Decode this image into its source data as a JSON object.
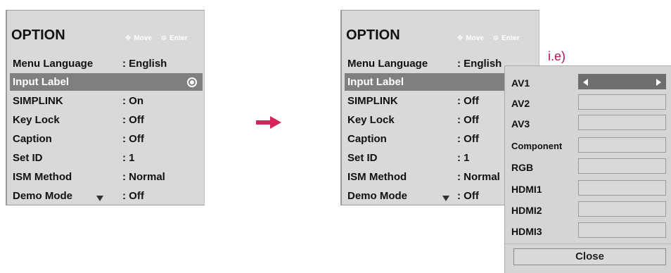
{
  "left_menu": {
    "title": "OPTION",
    "hint_move": "Move",
    "hint_enter": "Enter",
    "items": [
      {
        "label": "Menu Language",
        "value": ": English"
      },
      {
        "label": "Input Label",
        "value": ""
      },
      {
        "label": "SIMPLINK",
        "value": ": On"
      },
      {
        "label": "Key Lock",
        "value": ": Off"
      },
      {
        "label": "Caption",
        "value": ": Off"
      },
      {
        "label": "Set ID",
        "value": ": 1"
      },
      {
        "label": "ISM Method",
        "value": ": Normal"
      },
      {
        "label": "Demo Mode",
        "value": ": Off"
      }
    ]
  },
  "right_menu": {
    "title": "OPTION",
    "hint_move": "Move",
    "hint_enter": "Enter",
    "items": [
      {
        "label": "Menu Language",
        "value": ": English"
      },
      {
        "label": "Input Label",
        "value": ""
      },
      {
        "label": "SIMPLINK",
        "value": ": Off"
      },
      {
        "label": "Key Lock",
        "value": ": Off"
      },
      {
        "label": "Caption",
        "value": ": Off"
      },
      {
        "label": "Set ID",
        "value": ": 1"
      },
      {
        "label": "ISM Method",
        "value": ": Normal"
      },
      {
        "label": "Demo Mode",
        "value": ": Off"
      }
    ]
  },
  "example_label": "i.e)",
  "popup": {
    "inputs": [
      "AV1",
      "AV2",
      "AV3",
      "Component",
      "RGB",
      "HDMI1",
      "HDMI2",
      "HDMI3"
    ],
    "close_label": "Close"
  },
  "colors": {
    "selected_row": "#7f7f7f",
    "arrow": "#d6245a",
    "example_text": "#b0155b"
  }
}
